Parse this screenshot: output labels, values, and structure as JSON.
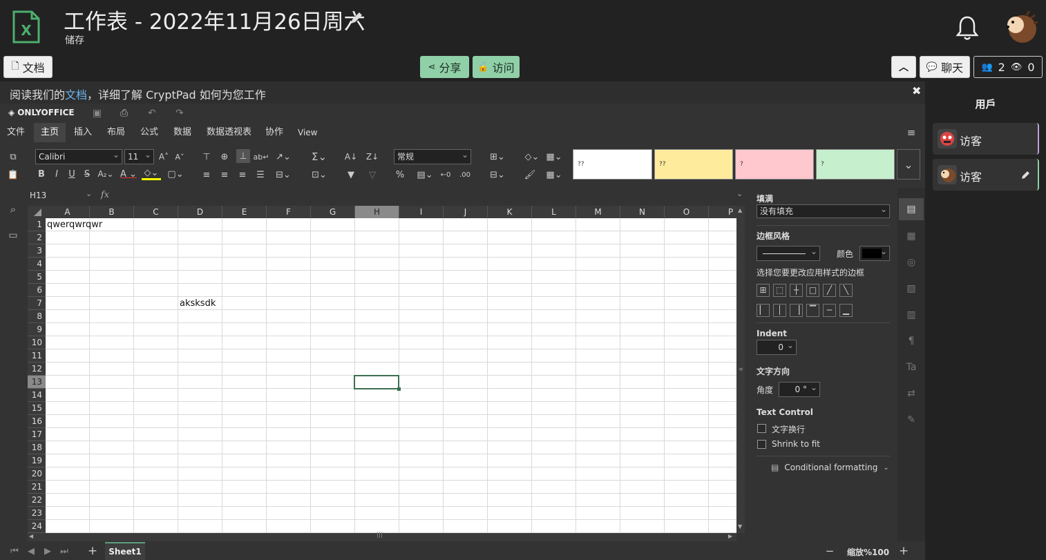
{
  "app": {
    "title": "工作表 - 2022年11月26日周六",
    "save_status": "储存"
  },
  "toolbar": {
    "docs_label": "文档",
    "share_label": "分享",
    "access_label": "访问",
    "chat_label": "聊天",
    "users_count": "2",
    "viewers_count": "0"
  },
  "infobar": {
    "prefix": "阅读我们的",
    "link": "文档",
    "suffix": "，详细了解 CryptPad 如何为您工作"
  },
  "users_panel": {
    "title": "用戶",
    "users": [
      {
        "name": "访客"
      },
      {
        "name": "访客"
      }
    ]
  },
  "onlyoffice": {
    "brand": "ONLYOFFICE",
    "tabs": [
      "文件",
      "主页",
      "插入",
      "布局",
      "公式",
      "数据",
      "数据透视表",
      "协作",
      "View"
    ],
    "active_tab": "主页",
    "font_name": "Calibri",
    "font_size": "11",
    "number_format": "常规",
    "style_samples": [
      "??",
      "??",
      "?",
      "?"
    ]
  },
  "formula_bar": {
    "cell_ref": "H13",
    "fx": "fx",
    "formula": ""
  },
  "grid": {
    "columns": [
      "A",
      "B",
      "C",
      "D",
      "E",
      "F",
      "G",
      "H",
      "I",
      "J",
      "K",
      "L",
      "M",
      "N",
      "O",
      "P"
    ],
    "selected_column": "H",
    "rows": [
      "1",
      "2",
      "3",
      "4",
      "5",
      "6",
      "7",
      "8",
      "9",
      "10",
      "11",
      "12",
      "13",
      "14",
      "15",
      "16",
      "17",
      "18",
      "19",
      "20",
      "21",
      "22",
      "23",
      "24"
    ],
    "selected_row": "13",
    "cells": [
      {
        "ref": "A1",
        "value": "qwerqwrqwr"
      },
      {
        "ref": "D7",
        "value": "aksksdk"
      }
    ]
  },
  "settings": {
    "fill_label": "填满",
    "fill_value": "没有填充",
    "border_style_label": "边框风格",
    "color_label": "颜色",
    "border_hint": "选择您要更改应用样式的边框",
    "indent_label": "Indent",
    "indent_value": "0",
    "text_direction_label": "文字方向",
    "angle_label": "角度",
    "angle_value": "0 °",
    "text_control_label": "Text Control",
    "wrap_label": "文字换行",
    "shrink_label": "Shrink to fit",
    "conditional_label": "Conditional formatting"
  },
  "bottom": {
    "sheet_name": "Sheet1",
    "zoom_label": "缩放%100"
  },
  "colors": {
    "accent_green": "#8fd0a8",
    "link_blue": "#6cb4ee",
    "selection": "#3c6f50"
  }
}
